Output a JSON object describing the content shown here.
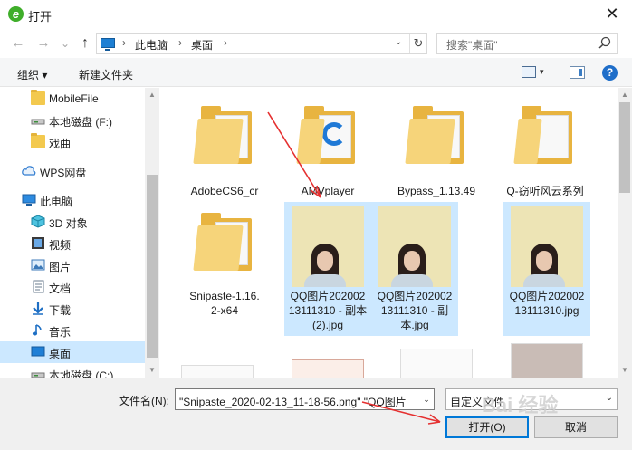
{
  "window": {
    "title": "打开",
    "close": "✕"
  },
  "nav": {
    "back": "←",
    "forward": "→",
    "recent": "⌄",
    "up": "↑"
  },
  "address": {
    "crumbs": [
      "此电脑",
      "桌面"
    ],
    "sep": "›",
    "refresh": "↻",
    "dropdown": "⌄"
  },
  "search": {
    "placeholder": "搜索\"桌面\""
  },
  "toolbar": {
    "organize": "组织 ▾",
    "new_folder": "新建文件夹",
    "help": "?",
    "view_dd": "▾"
  },
  "sidebar": {
    "items": [
      {
        "label": "MobileFile",
        "icon": "folder-icon"
      },
      {
        "label": "本地磁盘 (F:)",
        "icon": "drive-icon"
      },
      {
        "label": "戏曲",
        "icon": "folder-icon"
      },
      {
        "label": "WPS网盘",
        "icon": "cloud-icon"
      },
      {
        "label": "此电脑",
        "icon": "computer-icon"
      },
      {
        "label": "3D 对象",
        "icon": "3d-objects-icon"
      },
      {
        "label": "视频",
        "icon": "video-icon"
      },
      {
        "label": "图片",
        "icon": "pictures-icon"
      },
      {
        "label": "文档",
        "icon": "documents-icon"
      },
      {
        "label": "下载",
        "icon": "download-icon"
      },
      {
        "label": "音乐",
        "icon": "music-icon"
      },
      {
        "label": "桌面",
        "icon": "desktop-icon",
        "selected": true
      },
      {
        "label": "本地磁盘 (C:)",
        "icon": "drive-icon"
      }
    ],
    "scroll_up": "▲",
    "scroll_down": "▼"
  },
  "files": [
    {
      "name": "AdobeCS6_cr",
      "kind": "folder"
    },
    {
      "name": "AMVplayer",
      "kind": "folder"
    },
    {
      "name": "Bypass_1.13.49",
      "kind": "folder"
    },
    {
      "name": "Q-窃听风云系列",
      "kind": "folder"
    },
    {
      "name": "Snipaste-1.16.2-x64",
      "kind": "folder"
    },
    {
      "name": "QQ图片20200213111310 - 副本 (2).jpg",
      "kind": "image",
      "selected": true
    },
    {
      "name": "QQ图片20200213111310 - 副本.jpg",
      "kind": "image",
      "selected": true
    },
    {
      "name": "QQ图片20200213111310.jpg",
      "kind": "image",
      "selected": true
    }
  ],
  "footer": {
    "filename_label": "文件名(N):",
    "filename_value": "\"Snipaste_2020-02-13_11-18-56.png\" \"QQ图片",
    "filter_value": "自定义文件",
    "open_button": "打开(O)",
    "cancel_button": "取消",
    "dropdown": "⌄"
  },
  "watermark": "Bai 经验"
}
